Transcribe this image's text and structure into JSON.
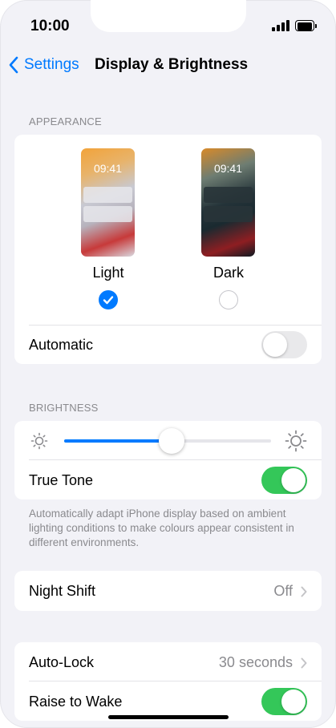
{
  "status_bar": {
    "time": "10:00"
  },
  "nav": {
    "back_label": "Settings",
    "title": "Display & Brightness"
  },
  "appearance": {
    "header": "APPEARANCE",
    "light": {
      "preview_time": "09:41",
      "label": "Light",
      "selected": true
    },
    "dark": {
      "preview_time": "09:41",
      "label": "Dark",
      "selected": false
    },
    "automatic": {
      "label": "Automatic",
      "on": false
    }
  },
  "brightness": {
    "header": "BRIGHTNESS",
    "level": 0.52,
    "true_tone": {
      "label": "True Tone",
      "on": true
    },
    "footnote": "Automatically adapt iPhone display based on ambient lighting conditions to make colours appear consistent in different environments."
  },
  "night_shift": {
    "label": "Night Shift",
    "value": "Off"
  },
  "auto_lock": {
    "label": "Auto-Lock",
    "value": "30 seconds"
  },
  "raise_to_wake": {
    "label": "Raise to Wake",
    "on": true
  },
  "colors": {
    "accent": "#007aff",
    "toggle_on": "#34c759",
    "background": "#f2f2f7"
  }
}
